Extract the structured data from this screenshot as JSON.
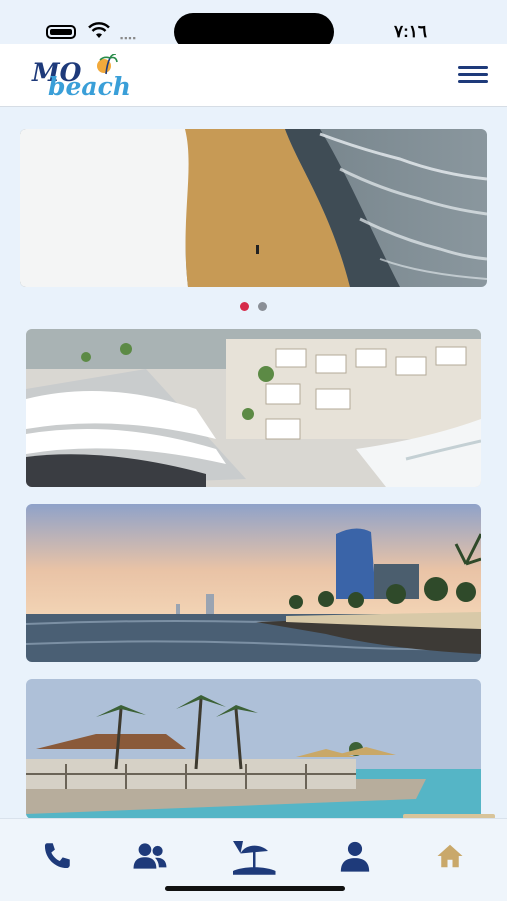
{
  "status_bar": {
    "time": "٧:١٦"
  },
  "header": {
    "logo_text_primary": "MO",
    "logo_text_secondary": "beach",
    "menu_icon": "hamburger-menu-icon"
  },
  "carousel": {
    "slide_count": 2,
    "active_index": 0
  },
  "cards": [
    {
      "subject": "beach resort aerial"
    },
    {
      "subject": "corniche sunset tower"
    },
    {
      "subject": "beach umbrellas palms"
    }
  ],
  "tab_bar": {
    "items": [
      {
        "icon": "phone-icon"
      },
      {
        "icon": "users-icon"
      },
      {
        "icon": "beach-umbrella-icon"
      },
      {
        "icon": "user-icon"
      },
      {
        "icon": "home-icon",
        "active": true
      }
    ],
    "accent_color": "#1e3a7a",
    "active_color": "#c9a86a"
  }
}
